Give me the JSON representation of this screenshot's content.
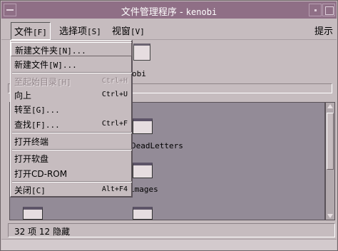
{
  "window": {
    "title": "文件管理程序 - ",
    "host": "kenobi"
  },
  "menubar": {
    "file": "文件",
    "file_key": "[F]",
    "options": "选择项",
    "options_key": "[S]",
    "view": "视窗",
    "view_key": "[V]",
    "help": "提示"
  },
  "content": {
    "path_label": "obi",
    "files": [
      {
        "name": "DeadLetters"
      },
      {
        "name": "images"
      }
    ]
  },
  "status": {
    "text": "32 项 12 隐藏"
  },
  "file_menu": {
    "items": [
      {
        "label": "新建文件夹",
        "key": "[N]...",
        "accelerator": "",
        "disabled": false,
        "highlighted": true
      },
      {
        "label": "新建文件",
        "key": "[W]...",
        "accelerator": "",
        "disabled": false,
        "highlighted": false
      },
      {
        "label": "至起始目录",
        "key": "[H]",
        "accelerator": "Ctrl+H",
        "disabled": true,
        "highlighted": false
      },
      {
        "label": "向上",
        "key": "",
        "accelerator": "Ctrl+U",
        "disabled": false,
        "highlighted": false
      },
      {
        "label": "转至",
        "key": "[G]...",
        "accelerator": "",
        "disabled": false,
        "highlighted": false
      },
      {
        "label": "查找",
        "key": "[F]...",
        "accelerator": "Ctrl+F",
        "disabled": false,
        "highlighted": false
      },
      {
        "label": "打开终端",
        "key": "",
        "accelerator": "",
        "disabled": false,
        "highlighted": false
      },
      {
        "label": "打开软盘",
        "key": "",
        "accelerator": "",
        "disabled": false,
        "highlighted": false
      },
      {
        "label": "打开CD-ROM",
        "key": "",
        "accelerator": "",
        "disabled": false,
        "highlighted": false
      },
      {
        "label": "关闭",
        "key": "[C]",
        "accelerator": "Alt+F4",
        "disabled": false,
        "highlighted": false
      }
    ]
  },
  "colors": {
    "titlebar": "#8f6f86",
    "window_bg": "#c6bcbf",
    "file_pane": "#938b97"
  },
  "icons": [
    "window-menu-icon",
    "minimize-icon",
    "maximize-icon",
    "folder-icon",
    "scroll-up-icon",
    "scroll-down-icon"
  ]
}
